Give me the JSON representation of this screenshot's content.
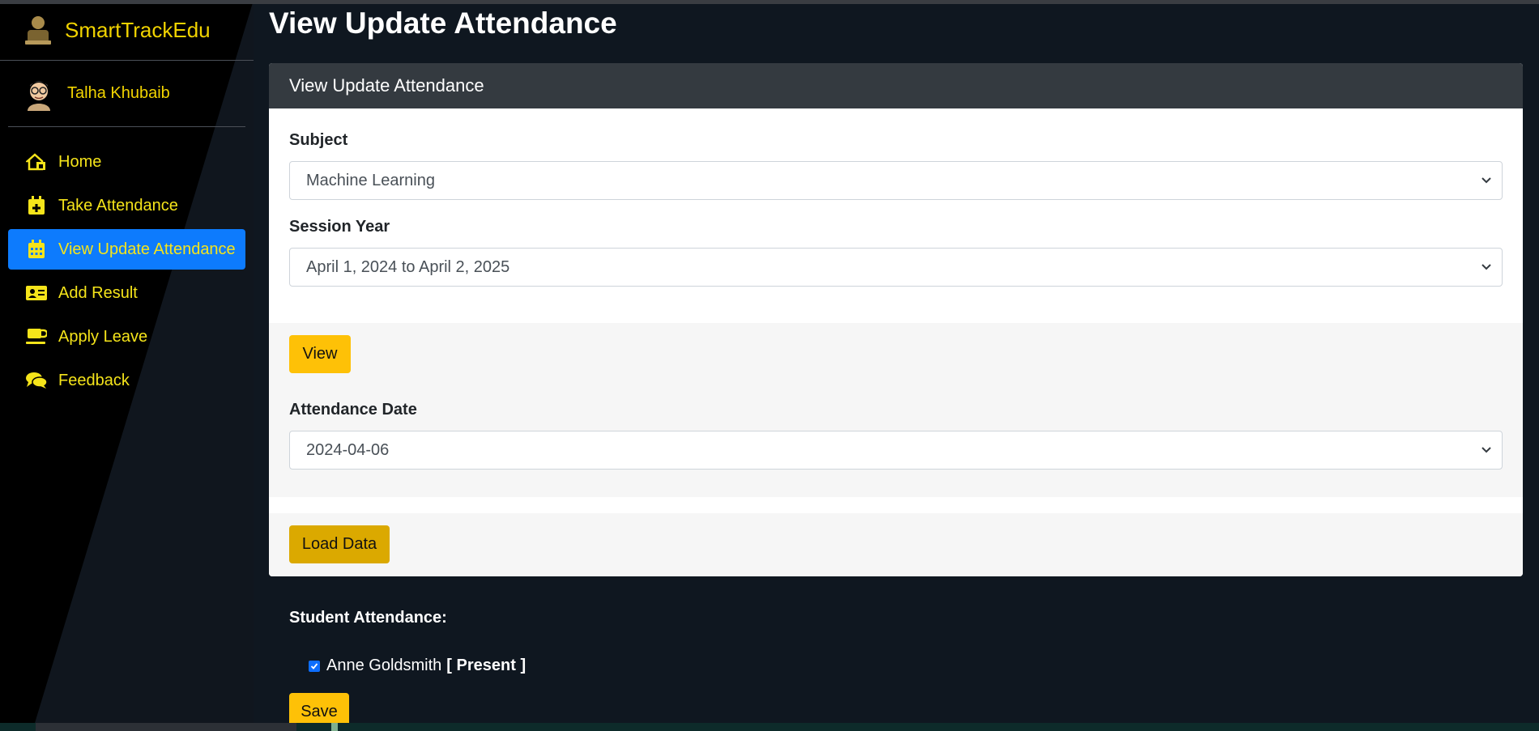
{
  "app": {
    "brand": "SmartTrackEdu",
    "user_name": "Talha Khubaib"
  },
  "sidebar": {
    "items": [
      {
        "label": "Home",
        "icon": "home-icon",
        "active": false
      },
      {
        "label": "Take Attendance",
        "icon": "calendar-plus-icon",
        "active": false
      },
      {
        "label": "View Update Attendance",
        "icon": "calendar-icon",
        "active": true
      },
      {
        "label": "Add Result",
        "icon": "id-card-icon",
        "active": false
      },
      {
        "label": "Apply Leave",
        "icon": "coffee-cup-icon",
        "active": false
      },
      {
        "label": "Feedback",
        "icon": "chat-bubbles-icon",
        "active": false
      }
    ]
  },
  "main": {
    "page_title": "View Update Attendance",
    "card_title": "View Update Attendance",
    "subject": {
      "label": "Subject",
      "value": "Machine Learning"
    },
    "session_year": {
      "label": "Session Year",
      "value": "April 1, 2024 to April 2, 2025"
    },
    "view_button": "View",
    "attendance_date": {
      "label": "Attendance Date",
      "value": "2024-04-06"
    },
    "load_button": "Load Data",
    "student_attendance_title": "Student Attendance:",
    "students": [
      {
        "name": "Anne Goldsmith",
        "status": "[ Present ]",
        "checked": true
      }
    ],
    "save_button": "Save"
  },
  "colors": {
    "accent_yellow": "#fec107",
    "load_button": "#dba900",
    "active_nav": "#0d7bfd",
    "sidebar_text": "#f5e41a",
    "card_header": "#343a40",
    "background": "#0f1720"
  }
}
